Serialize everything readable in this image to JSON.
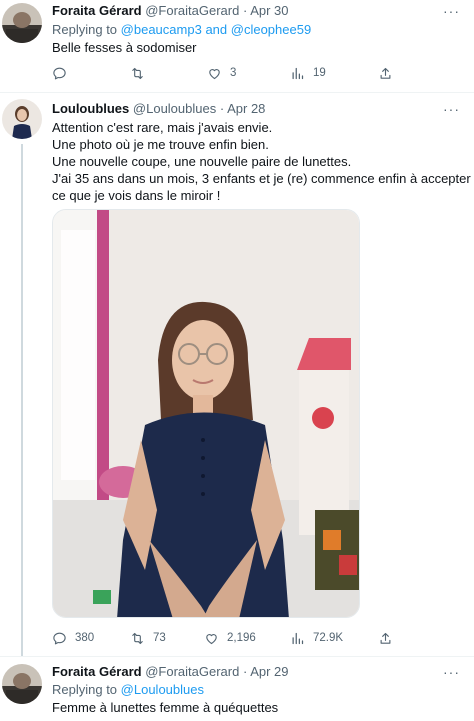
{
  "tweets": [
    {
      "name": "Foraita Gérard",
      "handle": "@ForaitaGerard",
      "date": "Apr 30",
      "replying_prefix": "Replying to",
      "mentions": [
        "@beaucamp3",
        "@cleophee59"
      ],
      "mention_joiner": "and",
      "text": "Belle fesses à sodomiser",
      "stats": {
        "replies": "",
        "retweets": "",
        "likes": "3",
        "views": "19"
      }
    },
    {
      "name": "Louloublues",
      "handle": "@Louloublues",
      "date": "Apr 28",
      "text_lines": [
        "Attention c'est rare, mais j'avais envie.",
        "Une photo où je me trouve enfin bien.",
        "Une nouvelle coupe, une nouvelle paire de lunettes.",
        "J'ai 35 ans dans un mois, 3 enfants et je (re) commence enfin à accepter",
        "ce que je vois dans le miroir !"
      ],
      "stats": {
        "replies": "380",
        "retweets": "73",
        "likes": "2,196",
        "views": "72.9K"
      }
    },
    {
      "name": "Foraita Gérard",
      "handle": "@ForaitaGerard",
      "date": "Apr 29",
      "replying_prefix": "Replying to",
      "mentions": [
        "@Louloublues"
      ],
      "text": "Femme à lunettes femme à quéquettes"
    }
  ],
  "separator": "·",
  "more_label": "···",
  "icons": {
    "reply": "reply-icon",
    "retweet": "retweet-icon",
    "like": "heart-icon",
    "views": "views-icon",
    "share": "share-icon"
  },
  "colors": {
    "accent": "#1d9bf0",
    "muted": "#536471",
    "text": "#0f1419",
    "thread_line": "#cfd9de"
  }
}
